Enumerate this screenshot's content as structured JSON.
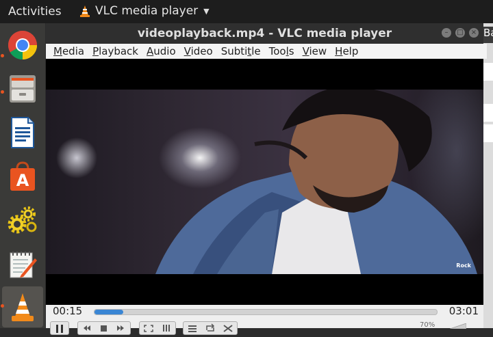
{
  "topbar": {
    "activities": "Activities",
    "app_name": "VLC media player"
  },
  "dock": {
    "items": [
      "chrome-icon",
      "file-cabinet-icon",
      "writer-icon",
      "software-store-icon",
      "settings-gears-icon",
      "text-editor-icon",
      "vlc-cone-icon"
    ],
    "active": "vlc-cone-icon"
  },
  "window": {
    "title": "videoplayback.mp4 - VLC media player",
    "buttons": [
      "minimize",
      "maximize",
      "close"
    ]
  },
  "menu": {
    "items": [
      {
        "label": "Media",
        "mnemonic": 0
      },
      {
        "label": "Playback",
        "mnemonic": 0
      },
      {
        "label": "Audio",
        "mnemonic": 0
      },
      {
        "label": "Video",
        "mnemonic": 0
      },
      {
        "label": "Subtitle",
        "mnemonic": 5
      },
      {
        "label": "Tools",
        "mnemonic": 3
      },
      {
        "label": "View",
        "mnemonic": 0
      },
      {
        "label": "Help",
        "mnemonic": 0
      }
    ]
  },
  "player": {
    "current_time": "00:15",
    "total_time": "03:01",
    "progress": 0.083,
    "volume": "70%",
    "watermark": "Rock"
  },
  "background_window": {
    "visible_text": "Ba"
  },
  "colors": {
    "accent": "#e95420",
    "seek_fill": "#3a86d4",
    "vlc_orange": "#f28a1a"
  }
}
